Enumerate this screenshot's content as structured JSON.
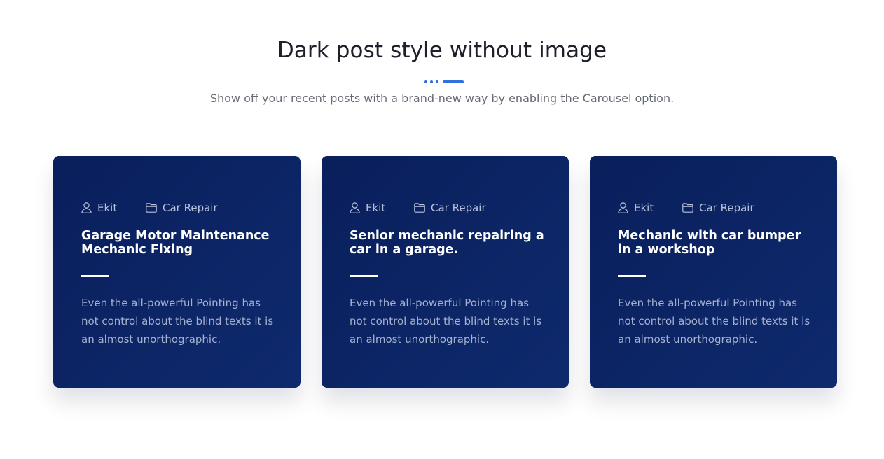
{
  "section": {
    "title": "Dark post style without image",
    "subtitle": "Show off your recent posts with a brand-new way by enabling the Carousel option.",
    "accent_color": "#2f6fe0"
  },
  "posts": [
    {
      "author": "Ekit",
      "category": "Car Repair",
      "title": "Garage Motor Maintenance Mechanic Fixing",
      "excerpt": "Even the all-powerful Pointing has not control about the blind texts it is an almost unorthographic."
    },
    {
      "author": "Ekit",
      "category": "Car Repair",
      "title": "Senior mechanic repairing a car in a garage.",
      "excerpt": "Even the all-powerful Pointing has not control about the blind texts it is an almost unorthographic."
    },
    {
      "author": "Ekit",
      "category": "Car Repair",
      "title": "Mechanic with car bumper in a workshop",
      "excerpt": "Even the all-powerful Pointing has not control about the blind texts it is an almost unorthographic."
    }
  ],
  "icons": {
    "author": "user-icon",
    "category": "folder-icon"
  },
  "colors": {
    "card_background": "#0c2463",
    "title_text": "#ffffff",
    "meta_text": "#b9c2db"
  }
}
